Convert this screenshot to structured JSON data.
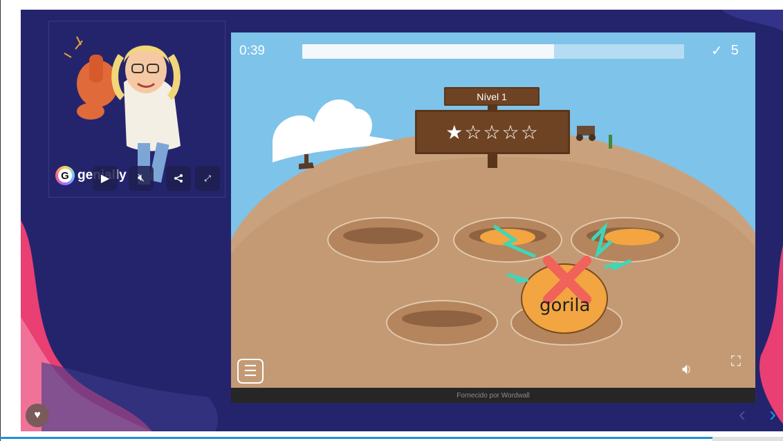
{
  "presentation": {
    "brand": "genially",
    "controls": {
      "play_icon": "play-icon",
      "mute_icon": "mute-icon",
      "share_icon": "share-icon",
      "expand_icon": "expand-icon"
    },
    "like_icon": "heart-icon",
    "nav": {
      "prev": "‹",
      "next": "›"
    }
  },
  "game": {
    "timer": "0:39",
    "progress": 0.66,
    "score_check": "✓",
    "score": "5",
    "level_label": "Nível 1",
    "stars": "★☆☆☆☆",
    "current_word": "gorila",
    "footer": "Fornecido por Wordwall",
    "menu_icon": "menu-icon",
    "sound_icon": "speaker-icon",
    "fullscreen_icon": "fullscreen-icon"
  },
  "colors": {
    "slide_bg": "#24246d",
    "accent_pink": "#e93f73",
    "sky": "#7ec3ea",
    "ground": "#c9a27d",
    "wrong_red": "#f0625a"
  }
}
